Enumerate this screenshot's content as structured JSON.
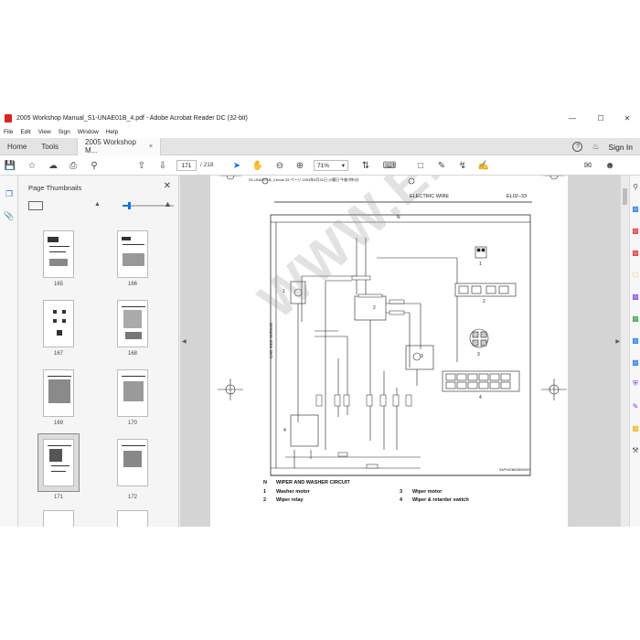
{
  "window": {
    "title": "2005 Workshop Manual_S1-UNAE01B_4.pdf - Adobe Acrobat Reader DC (32-bit)",
    "minimize": "—",
    "maximize": "☐",
    "close": "✕"
  },
  "menu": [
    "File",
    "Edit",
    "View",
    "Sign",
    "Window",
    "Help"
  ],
  "tabs": {
    "home": "Home",
    "tools": "Tools",
    "document": "2005 Workshop M...",
    "close": "×"
  },
  "account": {
    "help": "?",
    "sign_in": "Sign In"
  },
  "toolbar": {
    "page_current": "171",
    "page_total": "/ 218",
    "zoom": "71%",
    "zoom_caret": "▾"
  },
  "thumbnails": {
    "title": "Page Thumbnails",
    "close": "✕",
    "labels": [
      "165",
      "166",
      "167",
      "168",
      "169",
      "170",
      "171",
      "172"
    ],
    "selected": "171",
    "size_fraction": 0.13
  },
  "document": {
    "header_left": "S1-UNAE01B_4.book  33 ページ  2004年8月31日  火曜日  午後7時0分",
    "section": "ELECTRIC WIRE",
    "code": "EL02–33",
    "diagram_tag": "N",
    "side_label": "CAB SIDE WIRING",
    "figure_id": "SAPH1ENB2B000001",
    "watermark": "WWW.EPCDEPO.COM",
    "components": [
      "1",
      "2",
      "3",
      "4"
    ],
    "legend": {
      "tag": "N",
      "title": "WIPER AND WASHER CIRCUIT",
      "items": [
        {
          "num": "1",
          "text": "Washer motor"
        },
        {
          "num": "2",
          "text": "Wiper relay"
        },
        {
          "num": "3",
          "text": "Wiper motor"
        },
        {
          "num": "4",
          "text": "Wiper & retarder switch"
        }
      ]
    }
  },
  "colors": {
    "accent": "#1473e6",
    "acrobat_red": "#d22222"
  }
}
